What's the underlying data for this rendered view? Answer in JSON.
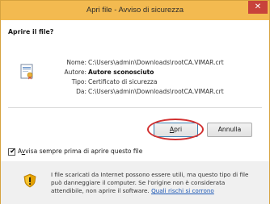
{
  "window": {
    "title": "Apri file - Avviso di sicurezza",
    "close_glyph": "✕"
  },
  "question": "Aprire il file?",
  "details": {
    "name_label": "Nome:",
    "name_value": "C:\\Users\\admin\\Downloads\\rootCA.VIMAR.crt",
    "author_label": "Autore:",
    "author_value": "Autore sconosciuto",
    "type_label": "Tipo:",
    "type_value": "Certificato di sicurezza",
    "from_label": "Da:",
    "from_value": "C:\\Users\\admin\\Downloads\\rootCA.VIMAR.crt"
  },
  "buttons": {
    "open_hotkey": "A",
    "open_rest": "pri",
    "cancel": "Annulla"
  },
  "checkbox": {
    "checked": true,
    "label_prefix": "A",
    "label_hotkey": "v",
    "label_rest": "visa sempre prima di aprire questo file"
  },
  "warning": {
    "text": "I file scaricati da Internet possono essere utili, ma questo tipo di file può danneggiare il computer. Se l'origine non è considerata attendibile, non aprire il software. ",
    "link": "Quali rischi si corrono"
  },
  "colors": {
    "titlebar": "#f3ba50",
    "close_button": "#c8433b",
    "highlight_ring": "#d23030",
    "link": "#1a56b5"
  },
  "icons": [
    "certificate-file-icon",
    "security-shield-icon",
    "close-icon"
  ]
}
